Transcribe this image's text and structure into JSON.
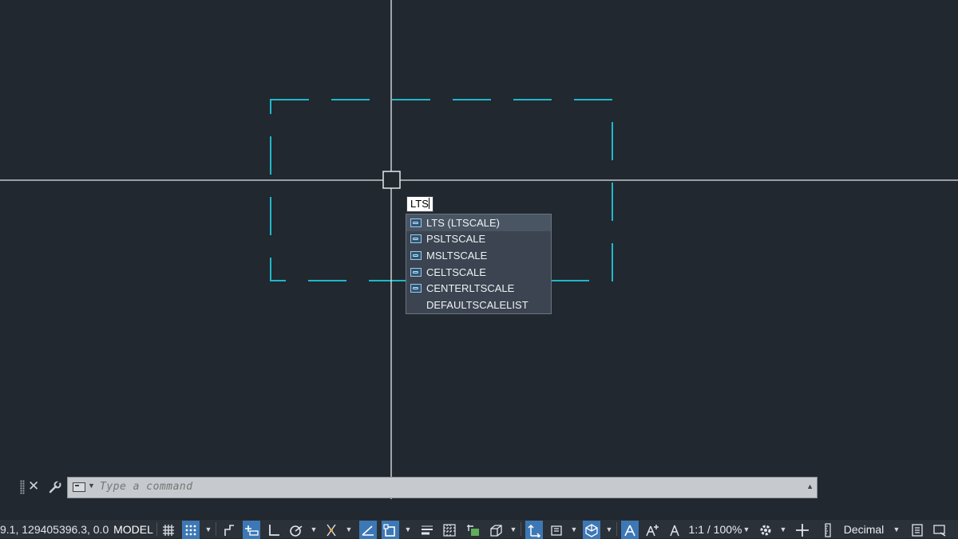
{
  "canvas": {
    "background": "#212830",
    "crosshair_color": "#e6e8ea",
    "entity_color": "#1fb8c8",
    "entity_linetype": "dashed"
  },
  "dynamic_input": {
    "value": "LTS",
    "suggestions": [
      {
        "label": "LTS (LTSCALE)",
        "icon": "sysvar-icon",
        "selected": true
      },
      {
        "label": "PSLTSCALE",
        "icon": "sysvar-icon",
        "selected": false
      },
      {
        "label": "MSLTSCALE",
        "icon": "sysvar-icon",
        "selected": false
      },
      {
        "label": "CELTSCALE",
        "icon": "sysvar-icon",
        "selected": false
      },
      {
        "label": "CENTERLTSCALE",
        "icon": "sysvar-icon",
        "selected": false
      },
      {
        "label": "DEFAULTSCALELIST",
        "icon": "",
        "selected": false
      }
    ]
  },
  "command_line": {
    "placeholder": "Type a command",
    "close_icon": "close-icon",
    "customize_icon": "wrench-icon"
  },
  "status_bar": {
    "coordinates": "9.1, 129405396.3, 0.0",
    "space": "MODEL",
    "annotation_scale": "1:1 / 100%",
    "units": "Decimal",
    "accent": "#3d78b6",
    "toggles": [
      {
        "name": "grid-icon",
        "on": false
      },
      {
        "name": "snap-mode-icon",
        "on": true
      },
      {
        "name": "infer-constraints-icon",
        "on": false
      },
      {
        "name": "dynamic-input-icon",
        "on": true
      },
      {
        "name": "ortho-icon",
        "on": false
      },
      {
        "name": "polar-tracking-icon",
        "on": false
      },
      {
        "name": "isometric-icon",
        "on": false
      },
      {
        "name": "object-snap-tracking-icon",
        "on": true
      },
      {
        "name": "object-snap-icon",
        "on": true
      },
      {
        "name": "lineweight-icon",
        "on": false
      },
      {
        "name": "transparency-icon",
        "on": false
      },
      {
        "name": "selection-cycling-icon",
        "on": false
      },
      {
        "name": "3d-object-snap-icon",
        "on": false
      },
      {
        "name": "dynamic-ucs-icon",
        "on": true
      },
      {
        "name": "selection-filter-icon",
        "on": false
      },
      {
        "name": "gizmo-icon",
        "on": true
      },
      {
        "name": "annotation-visibility-icon",
        "on": true
      },
      {
        "name": "auto-scale-icon",
        "on": false
      },
      {
        "name": "annotation-scale-icon",
        "on": false
      },
      {
        "name": "workspace-gear-icon",
        "on": false
      },
      {
        "name": "annotation-monitor-icon",
        "on": false
      },
      {
        "name": "units-icon",
        "on": false
      },
      {
        "name": "quick-properties-icon",
        "on": false
      },
      {
        "name": "customize-icon",
        "on": false
      }
    ]
  }
}
